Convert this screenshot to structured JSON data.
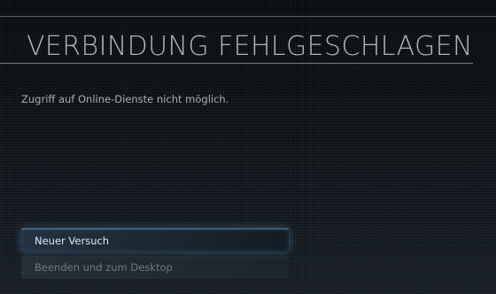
{
  "dialog": {
    "title": "VERBINDUNG FEHLGESCHLAGEN",
    "message": "Zugriff auf Online-Dienste nicht möglich."
  },
  "menu": {
    "items": [
      {
        "label": "Neuer Versuch",
        "selected": true
      },
      {
        "label": "Beenden und zum Desktop",
        "selected": false
      }
    ]
  },
  "colors": {
    "background": "#0b1015",
    "title": "#aeb7bf",
    "selected_glow": "#5fa5d7",
    "selected_text": "#dde9f2",
    "inactive_text": "#6c7a84"
  }
}
